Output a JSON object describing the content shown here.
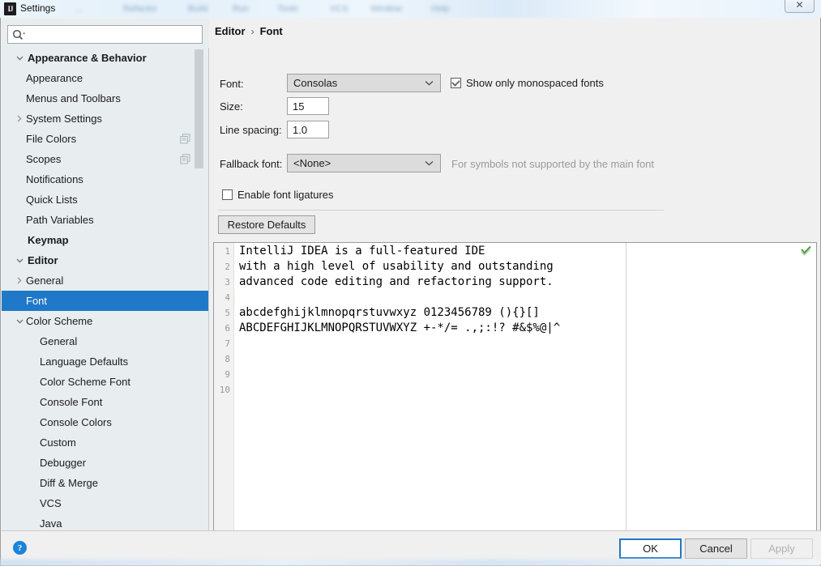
{
  "window": {
    "title": "Settings",
    "app_icon_text": "IJ",
    "close_label": "✕",
    "background_tabs": [
      "...",
      "Refactor",
      "Build",
      "Run",
      "Tools",
      "VCS",
      "Window",
      "Help"
    ]
  },
  "sidebar": {
    "search": {
      "value": "",
      "placeholder": ""
    },
    "icons": {
      "search": "search-icon",
      "dropdown": "chevron-down-icon",
      "copy": "copy-icon"
    },
    "items": [
      {
        "label": "Appearance & Behavior",
        "level": 0,
        "twisty": "expanded",
        "bold": true,
        "selected": false,
        "badge": false
      },
      {
        "label": "Appearance",
        "level": 1,
        "twisty": "none",
        "bold": false,
        "selected": false,
        "badge": false
      },
      {
        "label": "Menus and Toolbars",
        "level": 1,
        "twisty": "none",
        "bold": false,
        "selected": false,
        "badge": false
      },
      {
        "label": "System Settings",
        "level": 1,
        "twisty": "collapsed",
        "bold": false,
        "selected": false,
        "badge": false
      },
      {
        "label": "File Colors",
        "level": 1,
        "twisty": "none",
        "bold": false,
        "selected": false,
        "badge": true
      },
      {
        "label": "Scopes",
        "level": 1,
        "twisty": "none",
        "bold": false,
        "selected": false,
        "badge": true
      },
      {
        "label": "Notifications",
        "level": 1,
        "twisty": "none",
        "bold": false,
        "selected": false,
        "badge": false
      },
      {
        "label": "Quick Lists",
        "level": 1,
        "twisty": "none",
        "bold": false,
        "selected": false,
        "badge": false
      },
      {
        "label": "Path Variables",
        "level": 1,
        "twisty": "none",
        "bold": false,
        "selected": false,
        "badge": false
      },
      {
        "label": "Keymap",
        "level": 0,
        "twisty": "none",
        "bold": true,
        "selected": false,
        "badge": false
      },
      {
        "label": "Editor",
        "level": 0,
        "twisty": "expanded",
        "bold": true,
        "selected": false,
        "badge": false
      },
      {
        "label": "General",
        "level": 1,
        "twisty": "collapsed",
        "bold": false,
        "selected": false,
        "badge": false
      },
      {
        "label": "Font",
        "level": 1,
        "twisty": "none",
        "bold": false,
        "selected": true,
        "badge": false
      },
      {
        "label": "Color Scheme",
        "level": 1,
        "twisty": "expanded",
        "bold": false,
        "selected": false,
        "badge": false
      },
      {
        "label": "General",
        "level": 2,
        "twisty": "none",
        "bold": false,
        "selected": false,
        "badge": false
      },
      {
        "label": "Language Defaults",
        "level": 2,
        "twisty": "none",
        "bold": false,
        "selected": false,
        "badge": false
      },
      {
        "label": "Color Scheme Font",
        "level": 2,
        "twisty": "none",
        "bold": false,
        "selected": false,
        "badge": false
      },
      {
        "label": "Console Font",
        "level": 2,
        "twisty": "none",
        "bold": false,
        "selected": false,
        "badge": false
      },
      {
        "label": "Console Colors",
        "level": 2,
        "twisty": "none",
        "bold": false,
        "selected": false,
        "badge": false
      },
      {
        "label": "Custom",
        "level": 2,
        "twisty": "none",
        "bold": false,
        "selected": false,
        "badge": false
      },
      {
        "label": "Debugger",
        "level": 2,
        "twisty": "none",
        "bold": false,
        "selected": false,
        "badge": false
      },
      {
        "label": "Diff & Merge",
        "level": 2,
        "twisty": "none",
        "bold": false,
        "selected": false,
        "badge": false
      },
      {
        "label": "VCS",
        "level": 2,
        "twisty": "none",
        "bold": false,
        "selected": false,
        "badge": false
      },
      {
        "label": "Java",
        "level": 2,
        "twisty": "none",
        "bold": false,
        "selected": false,
        "badge": false
      }
    ]
  },
  "breadcrumb": {
    "parent": "Editor",
    "separator": "›",
    "current": "Font"
  },
  "form": {
    "font_label": "Font:",
    "font_value": "Consolas",
    "size_label": "Size:",
    "size_value": "15",
    "line_spacing_label": "Line spacing:",
    "line_spacing_value": "1.0",
    "monospaced_label": "Show only monospaced fonts",
    "monospaced_checked": true,
    "fallback_label": "Fallback font:",
    "fallback_value": "<None>",
    "fallback_hint": "For symbols not supported by the main font",
    "ligatures_label": "Enable font ligatures",
    "ligatures_checked": false,
    "restore_defaults_label": "Restore Defaults"
  },
  "preview": {
    "line_numbers": [
      "1",
      "2",
      "3",
      "4",
      "5",
      "6",
      "7",
      "8",
      "9",
      "10"
    ],
    "lines": [
      "IntelliJ IDEA is a full-featured IDE",
      "with a high level of usability and outstanding",
      "advanced code editing and refactoring support.",
      "",
      "abcdefghijklmnopqrstuvwxyz 0123456789 (){}[]",
      "ABCDEFGHIJKLMNOPQRSTUVWXYZ +-*/= .,;:!? #&$%@|^",
      "",
      "",
      "",
      ""
    ],
    "caret_line": 4,
    "status_icon": "checkmark-icon",
    "colors": {
      "caret_row": "#fdf6e3",
      "status_ok": "#4a9c3c"
    }
  },
  "footer": {
    "help_label": "?",
    "ok_label": "OK",
    "cancel_label": "Cancel",
    "apply_label": "Apply",
    "apply_disabled": true,
    "accent": "#1f78c8"
  }
}
